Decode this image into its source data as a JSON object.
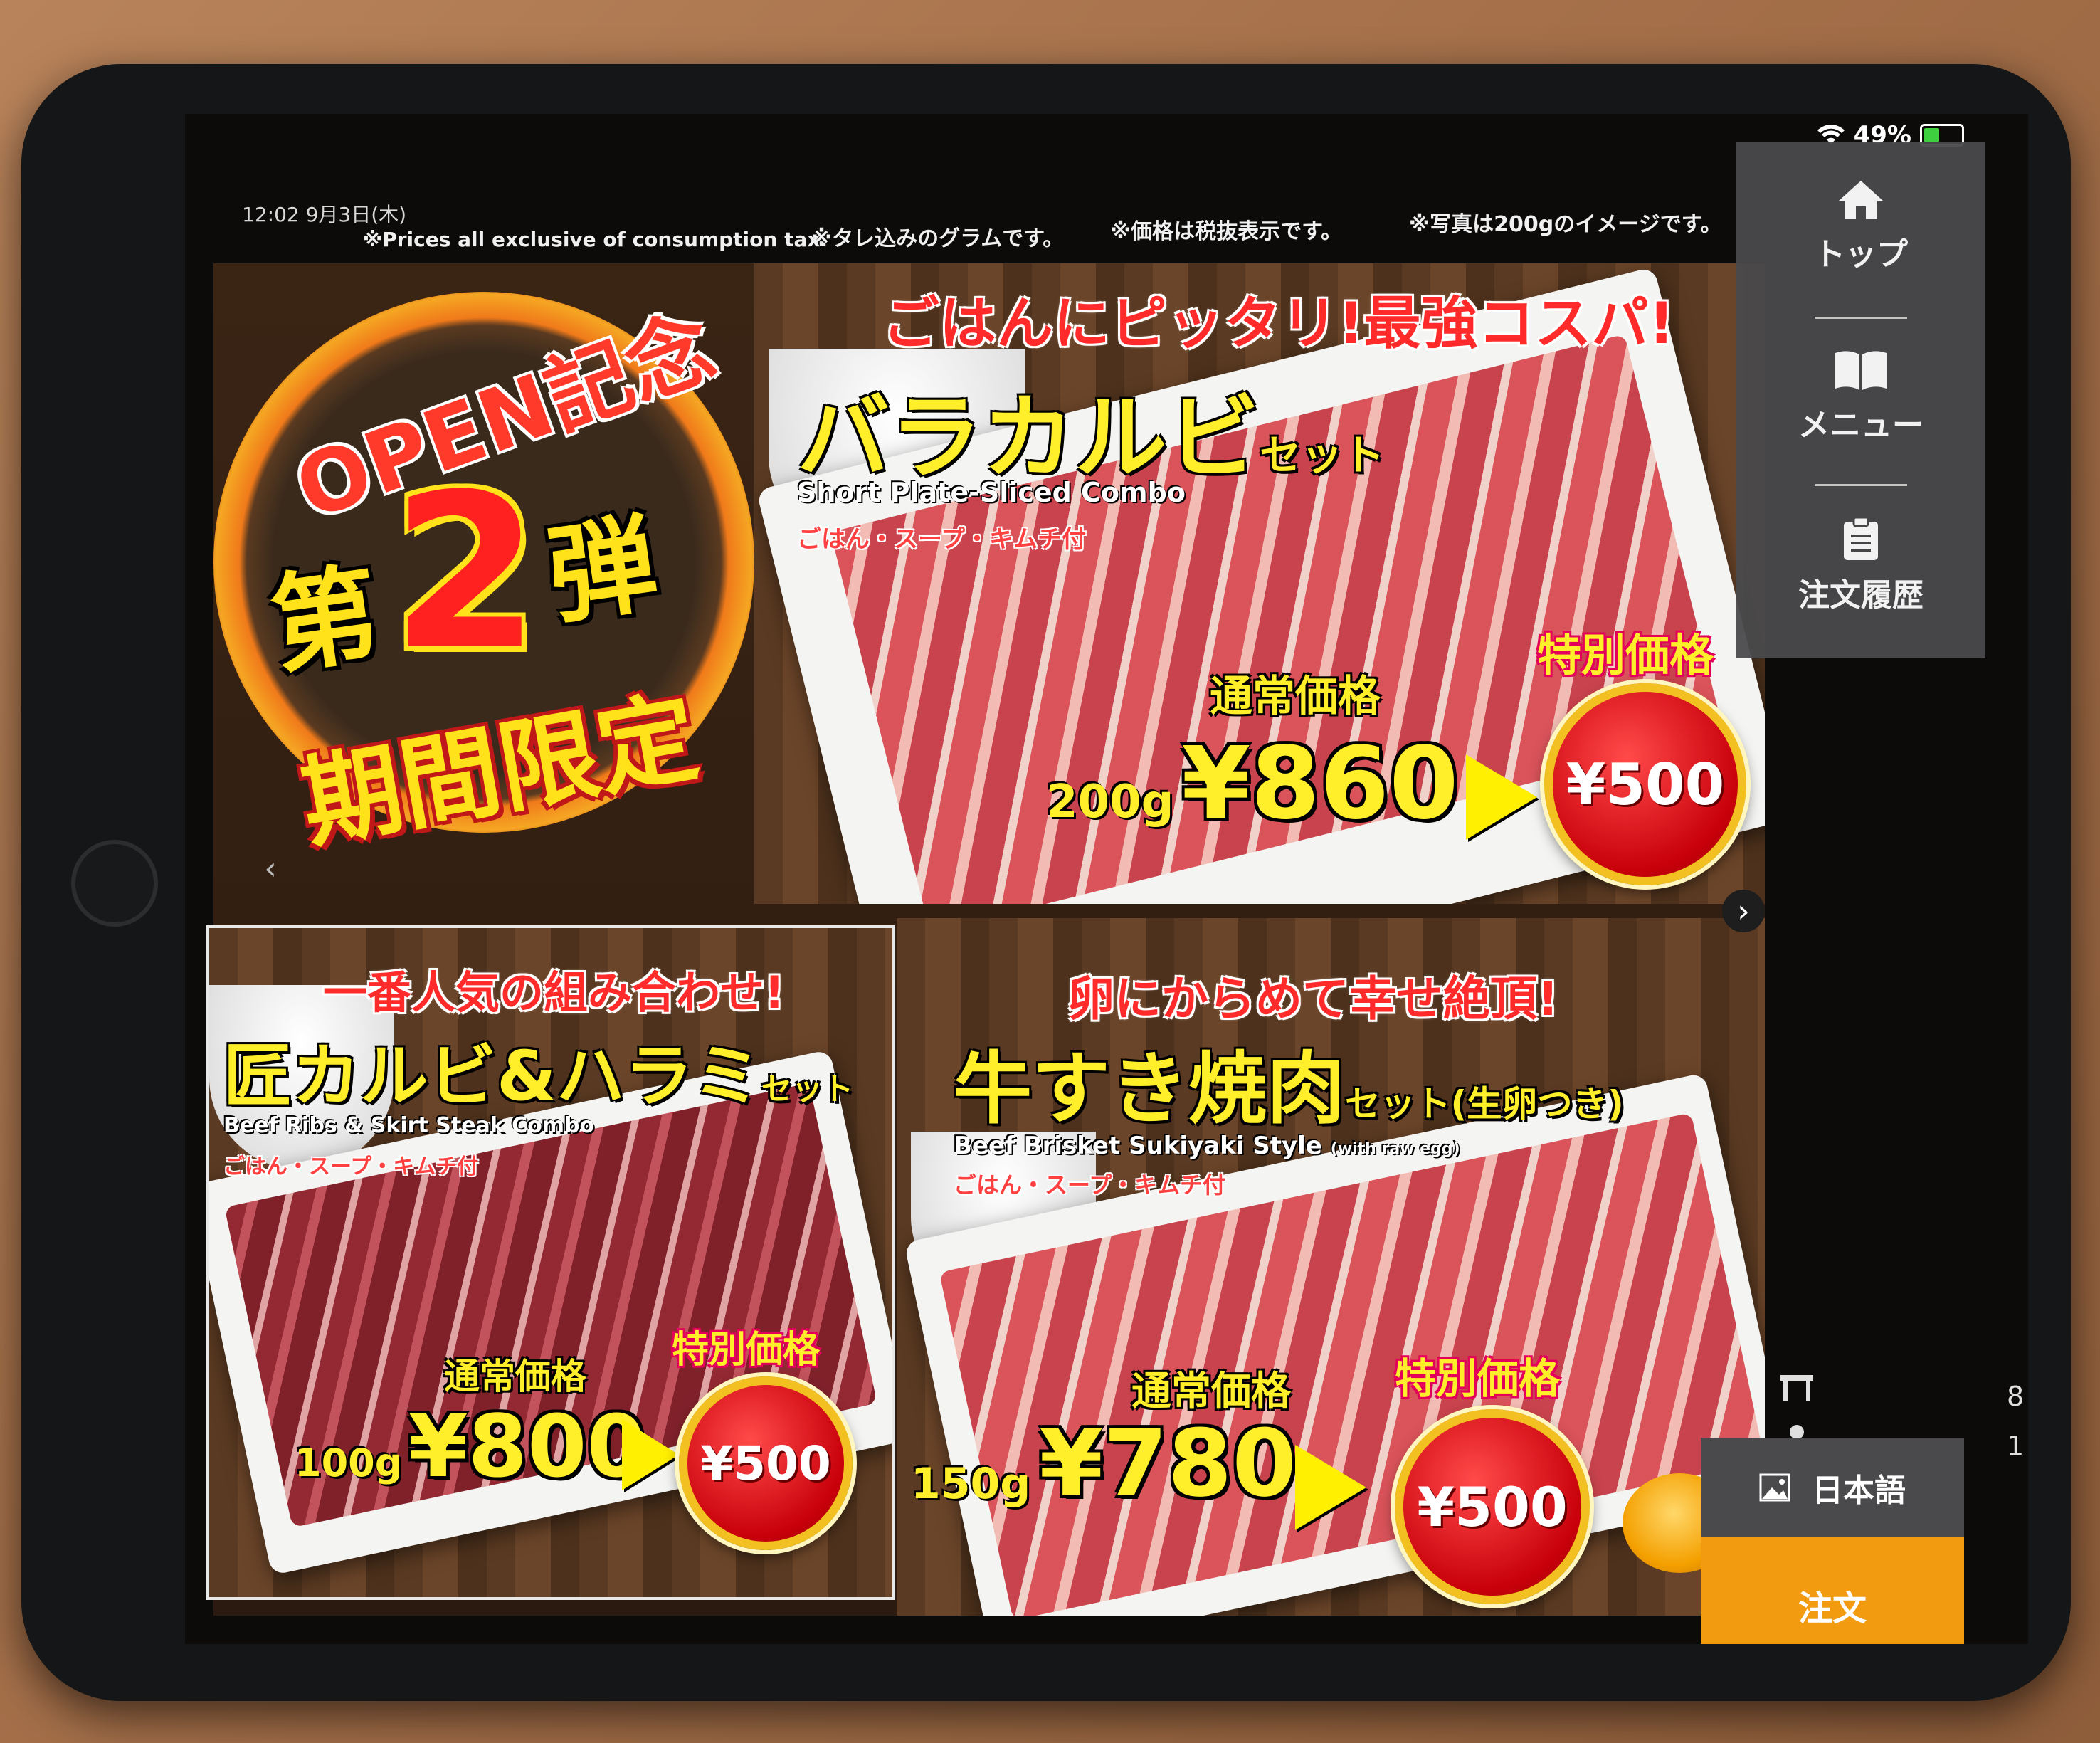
{
  "status": {
    "time": "12:02  9月3日(木)",
    "wifi_icon": "wifi-icon",
    "battery_percent": 49,
    "battery_label": "49%"
  },
  "notes": {
    "tax": "※Prices all exclusive of consumption tax.",
    "sauce": "※タレ込みのグラムです。",
    "price_tax": "※価格は税抜表示です。",
    "photo": "※写真は200gのイメージです。"
  },
  "badge": {
    "open": "OPEN記念",
    "dai": "第",
    "number": "2",
    "dan": "弾",
    "period": "期間限定"
  },
  "items": [
    {
      "tagline": "ごはんにピッタリ!最強コスパ!",
      "name": "バラカルビ",
      "set_suffix": "セット",
      "english": "Short Plate-Sliced Combo",
      "sides": "ごはん・スープ・キムチ付",
      "regular_label": "通常価格",
      "weight": "200g",
      "regular_price": "¥860",
      "special_label": "特別価格",
      "special_price": "¥500"
    },
    {
      "tagline": "一番人気の組み合わせ!",
      "name": "匠カルビ&ハラミ",
      "set_suffix": "セット",
      "english": "Beef Ribs & Skirt Steak Combo",
      "sides": "ごはん・スープ・キムチ付",
      "regular_label": "通常価格",
      "weight": "100g",
      "regular_price": "¥800",
      "special_label": "特別価格",
      "special_price": "¥500"
    },
    {
      "tagline": "卵にからめて幸せ絶頂!",
      "name": "牛すき焼肉",
      "set_suffix": "セット(生卵つき)",
      "english": "Beef Brisket Sukiyaki Style",
      "english_note": "(with raw egg)",
      "sides": "ごはん・スープ・キムチ付",
      "regular_label": "通常価格",
      "weight": "150g",
      "regular_price": "¥780",
      "special_label": "特別価格",
      "special_price": "¥500"
    }
  ],
  "sidebar": {
    "top_label": "トップ",
    "top_icon": "home-icon",
    "menu_label": "メニュー",
    "menu_icon": "book-icon",
    "history_label": "注文履歴",
    "history_icon": "clipboard-icon"
  },
  "table_info": {
    "table_icon": "table-icon",
    "table_number": "8",
    "person_icon": "person-icon",
    "guest_count": "1"
  },
  "language_button": {
    "label": "日本語",
    "icon": "image-icon"
  },
  "order_button": {
    "label": "注文"
  },
  "nav": {
    "prev": "‹",
    "next": "›"
  },
  "colors": {
    "order_button": "#f29a10",
    "sidebar": "#4a4a4c",
    "price_yellow": "#ffef2a",
    "sale_red": "#d8000a"
  }
}
